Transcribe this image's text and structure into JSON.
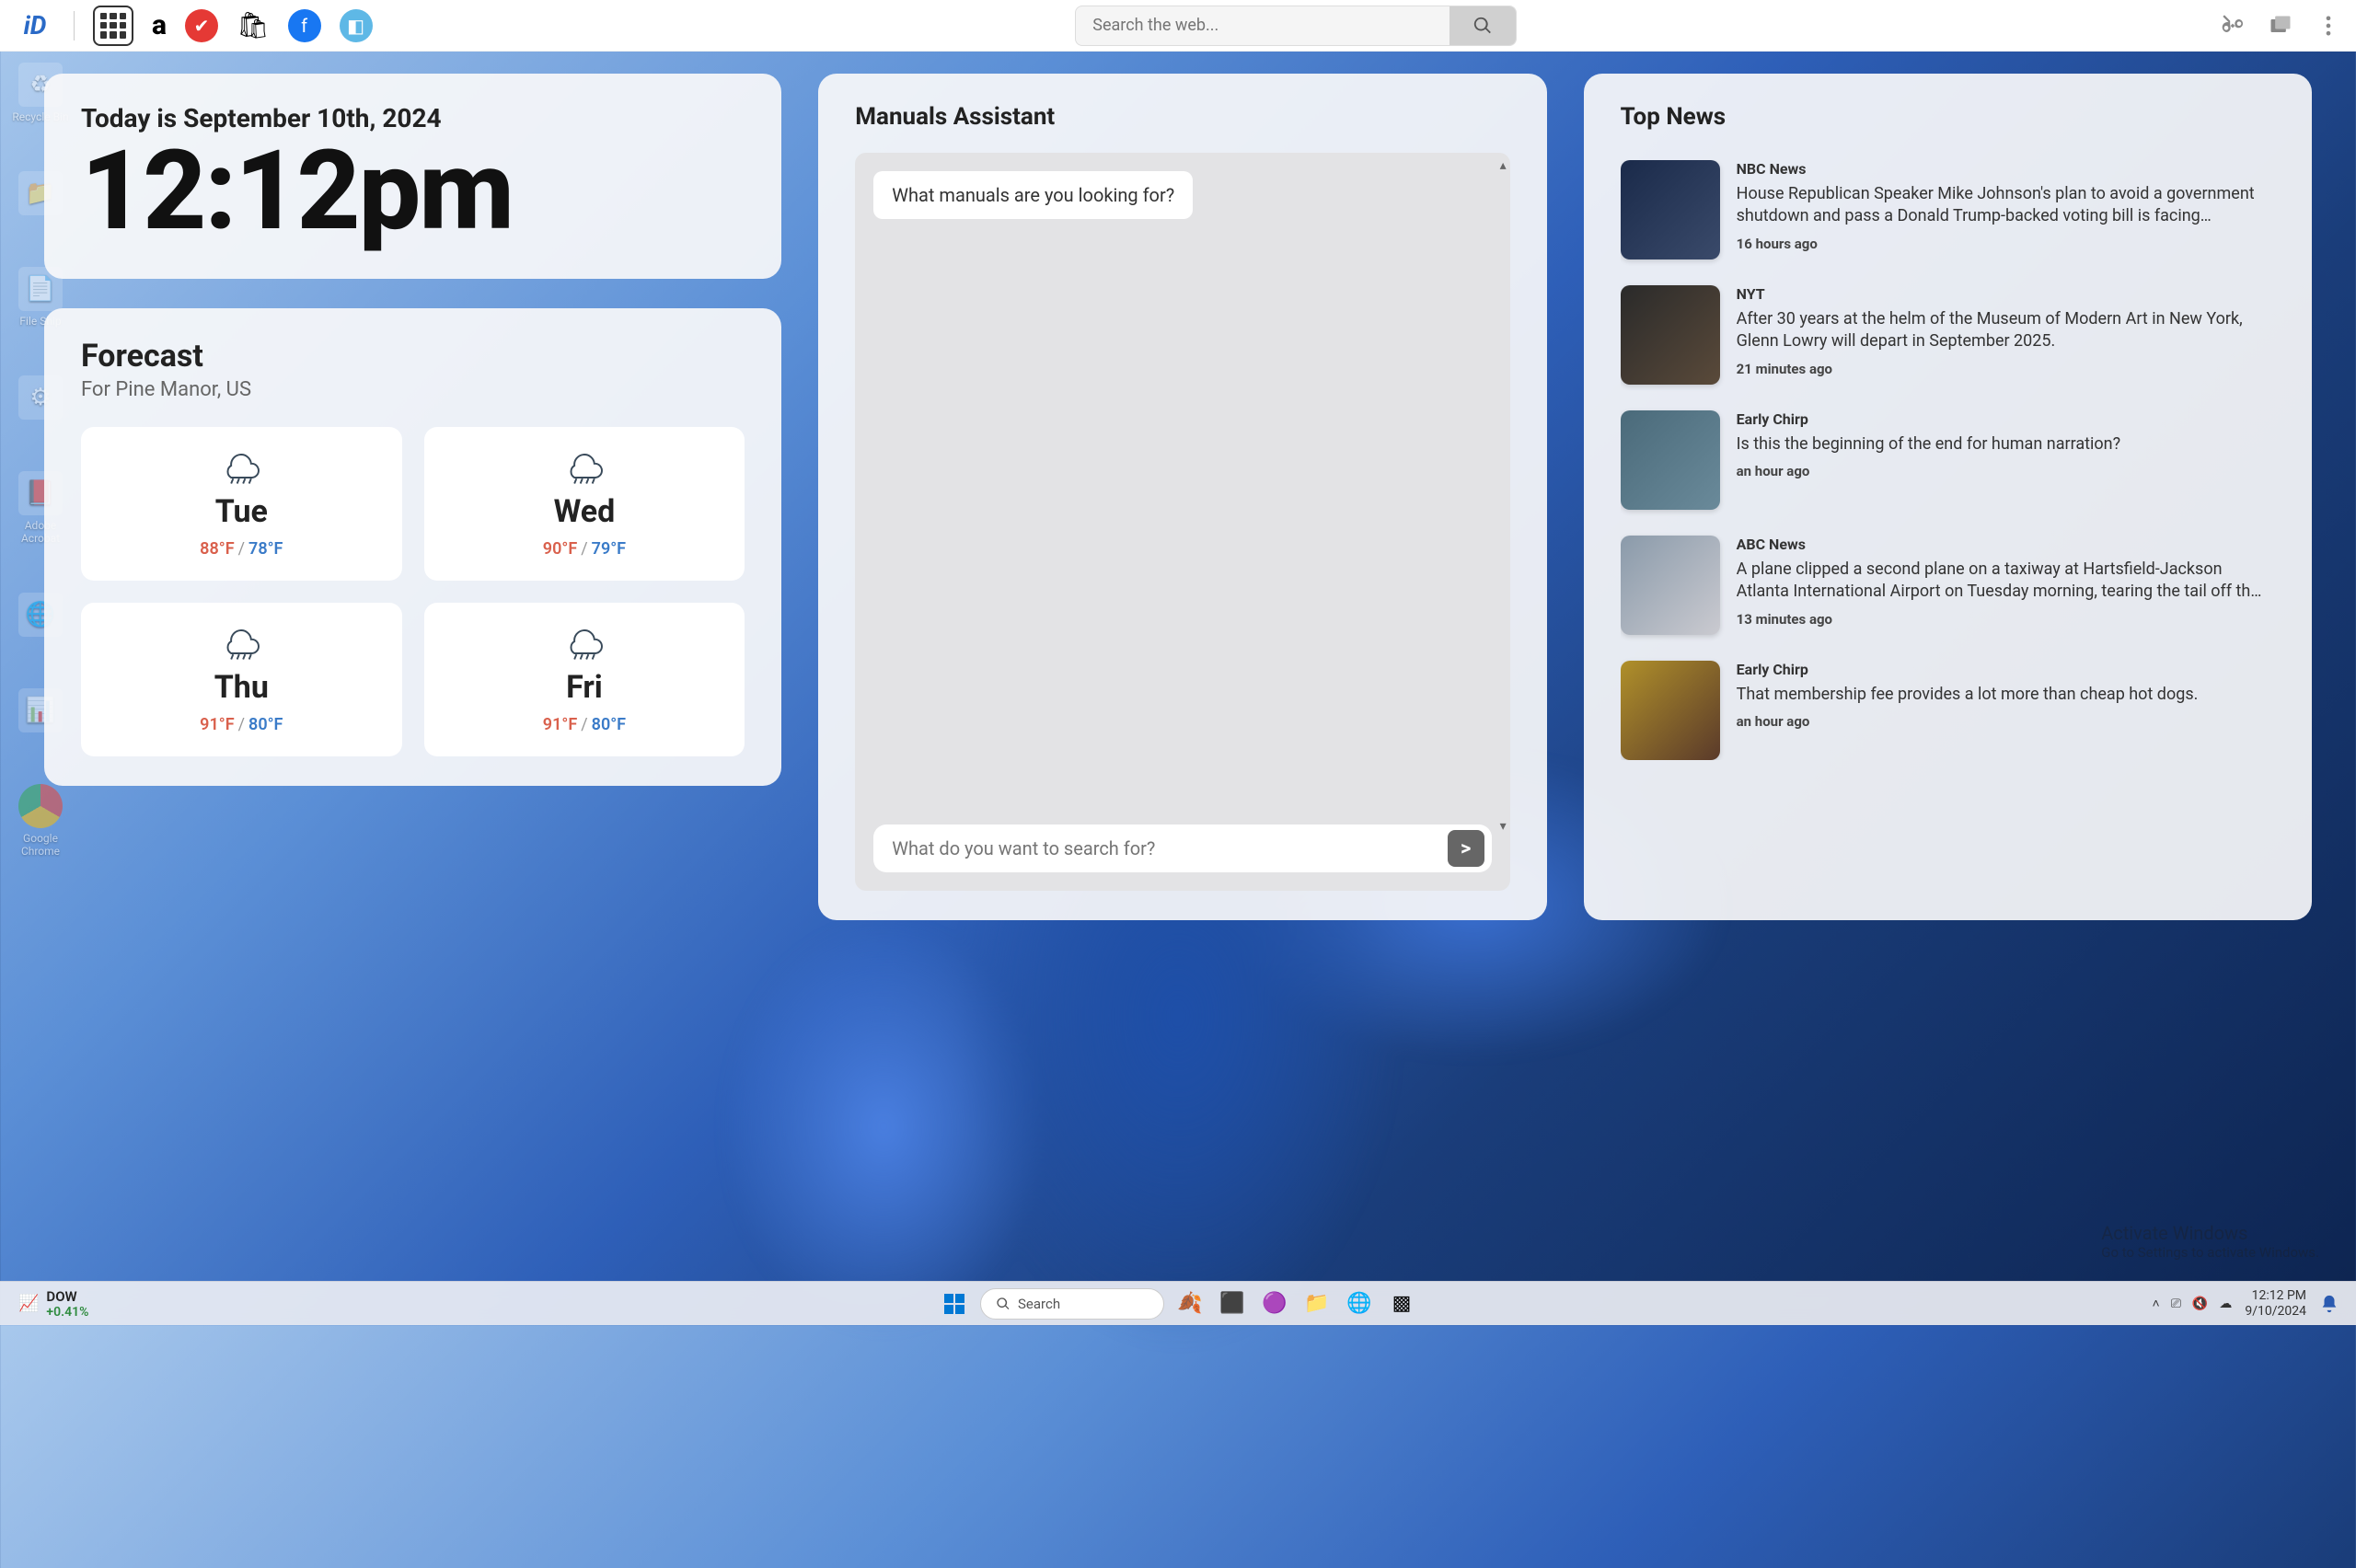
{
  "topbar": {
    "search_placeholder": "Search the web..."
  },
  "clock_card": {
    "date_line": "Today is September 10th, 2024",
    "time": "12:12pm"
  },
  "forecast": {
    "title": "Forecast",
    "subtitle": "For Pine Manor, US",
    "days": [
      {
        "day": "Tue",
        "hi": "88°F",
        "lo": "78°F"
      },
      {
        "day": "Wed",
        "hi": "90°F",
        "lo": "79°F"
      },
      {
        "day": "Thu",
        "hi": "91°F",
        "lo": "80°F"
      },
      {
        "day": "Fri",
        "hi": "91°F",
        "lo": "80°F"
      }
    ]
  },
  "assistant": {
    "title": "Manuals Assistant",
    "bubble": "What manuals are you looking for?",
    "input_placeholder": "What do you want to search for?",
    "send_label": ">"
  },
  "news": {
    "title": "Top News",
    "items": [
      {
        "source": "NBC News",
        "headline": "House Republican Speaker Mike Johnson's plan to avoid a government shutdown and pass a Donald Trump-backed voting bill is facing…",
        "time": "16 hours ago"
      },
      {
        "source": "NYT",
        "headline": "After 30 years at the helm of the Museum of Modern Art in New York, Glenn Lowry will depart in September 2025.",
        "time": "21 minutes ago"
      },
      {
        "source": "Early Chirp",
        "headline": "Is this the beginning of the end for human narration?",
        "time": "an hour ago"
      },
      {
        "source": "ABC News",
        "headline": "A plane clipped a second plane on a taxiway at Hartsfield-Jackson Atlanta International Airport on Tuesday morning, tearing the tail off the smaller…",
        "time": "13 minutes ago"
      },
      {
        "source": "Early Chirp",
        "headline": "That membership fee provides a lot more than cheap hot dogs.",
        "time": "an hour ago"
      }
    ]
  },
  "desktop": {
    "icons": [
      "Recycle Bin",
      "",
      "File Ship",
      "",
      "Adobe Acrobat",
      "",
      "",
      "Google Chrome"
    ]
  },
  "taskbar": {
    "stock_name": "DOW",
    "stock_change": "+0.41%",
    "search_label": "Search",
    "clock": "12:12 PM",
    "date": "9/10/2024"
  },
  "watermark": {
    "line1": "Activate Windows",
    "line2": "Go to Settings to activate Windows."
  }
}
